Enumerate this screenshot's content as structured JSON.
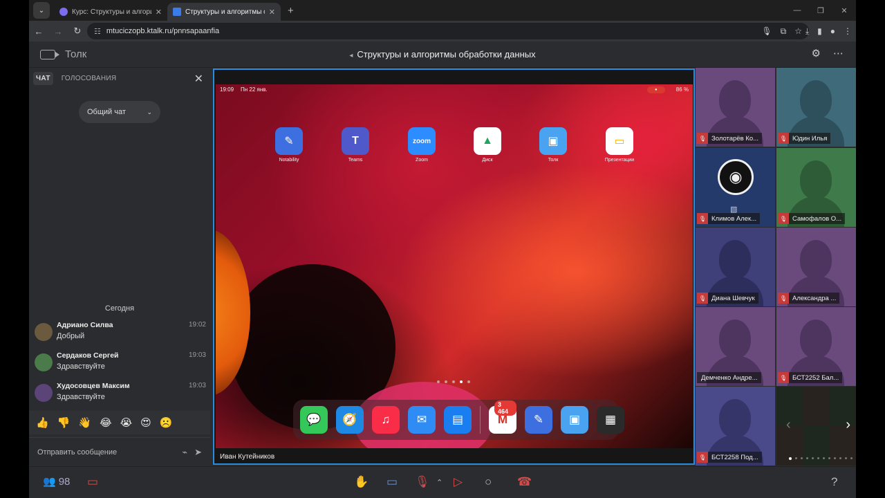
{
  "browser": {
    "tabs": [
      {
        "title": "Курс: Структуры и алгоритмы",
        "active": false,
        "favicon_color": "#7b6cf0"
      },
      {
        "title": "Структуры и алгоритмы о",
        "active": true,
        "favicon_color": "#3b7de8"
      }
    ],
    "url": "mtuciczopb.ktalk.ru/pnnsapaanfia"
  },
  "app": {
    "brand": "Толк",
    "meeting_title": "Структуры и алгоритмы обработки данных"
  },
  "chat": {
    "tabs": [
      {
        "label": "ЧАТ",
        "active": true
      },
      {
        "label": "ГОЛОСОВАНИЯ",
        "active": false
      }
    ],
    "channel": "Общий чат",
    "day_label": "Сегодня",
    "messages": [
      {
        "author": "Адриано Силва",
        "time": "19:02",
        "text": "Добрый",
        "avatar_color": "#6b5a3e"
      },
      {
        "author": "Сердаков Сергей",
        "time": "19:03",
        "text": "Здравствуйте",
        "avatar_color": "#4b7a4b"
      },
      {
        "author": "Худосовцев Максим",
        "time": "19:03",
        "text": "Здравствуйте",
        "avatar_color": "#5b4478"
      }
    ],
    "reactions": [
      "👍",
      "👎",
      "👋",
      "😂",
      "😭",
      "😍",
      "☹️"
    ],
    "input_placeholder": "Отправить сообщение"
  },
  "screen_share": {
    "presenter": "Иван Кутейников",
    "ipad_status": {
      "time": "19:09",
      "date": "Пн 22 янв.",
      "battery": "86 %"
    },
    "home_apps": [
      {
        "name": "Notability",
        "glyph": "✎",
        "color": "#3d6fe0"
      },
      {
        "name": "Teams",
        "glyph": "T",
        "color": "#5059c9"
      },
      {
        "name": "Zoom",
        "glyph": "zoom",
        "color": "#2d8cff"
      },
      {
        "name": "Диск",
        "glyph": "▲",
        "color": "#ffffff"
      },
      {
        "name": "Толк",
        "glyph": "▣",
        "color": "#4aa3f0"
      },
      {
        "name": "Презентации",
        "glyph": "▭",
        "color": "#f5b400"
      }
    ],
    "dock_apps": [
      {
        "name": "messages",
        "glyph": "💬",
        "color": "#34c759"
      },
      {
        "name": "safari",
        "glyph": "🧭",
        "color": "#1e88e5"
      },
      {
        "name": "music",
        "glyph": "♫",
        "color": "#fa2d48"
      },
      {
        "name": "mail",
        "glyph": "✉",
        "color": "#2f8cf5"
      },
      {
        "name": "files",
        "glyph": "▤",
        "color": "#1a7ef0"
      },
      {
        "name": "gmail",
        "glyph": "M",
        "color": "#ffffff",
        "badge": "3 464"
      },
      {
        "name": "notability",
        "glyph": "✎",
        "color": "#3d6fe0"
      },
      {
        "name": "tolk",
        "glyph": "▣",
        "color": "#4aa3f0"
      },
      {
        "name": "folder",
        "glyph": "▦",
        "color": "#2a2a2a"
      }
    ]
  },
  "participants": [
    {
      "name": "Золотарёв Ко...",
      "bg": "#6a4a7c",
      "sil": "#4e3560"
    },
    {
      "name": "Юдин Илья",
      "bg": "#3f6a7a",
      "sil": "#2e505c"
    },
    {
      "name": "Климов Алек...",
      "bg": "#243a6b",
      "sil": "",
      "obs": true
    },
    {
      "name": "Самофалов О...",
      "bg": "#3f7a4a",
      "sil": "#2d5c36"
    },
    {
      "name": "Диана Шевчук",
      "bg": "#3f3f7a",
      "sil": "#2e2e5c"
    },
    {
      "name": "Александра ...",
      "bg": "#6a4a7c",
      "sil": "#4e3560"
    },
    {
      "name": "Демченко Андре...",
      "bg": "#6a4a7c",
      "sil": "#4e3560"
    },
    {
      "name": "БСТ2252 Бал...",
      "bg": "#6a4a7c",
      "sil": "#4e3560"
    },
    {
      "name": "БСТ2258 Под...",
      "bg": "#4a4a8a",
      "sil": "#35356a"
    }
  ],
  "toolbar": {
    "participant_count": "98",
    "help": "?"
  }
}
